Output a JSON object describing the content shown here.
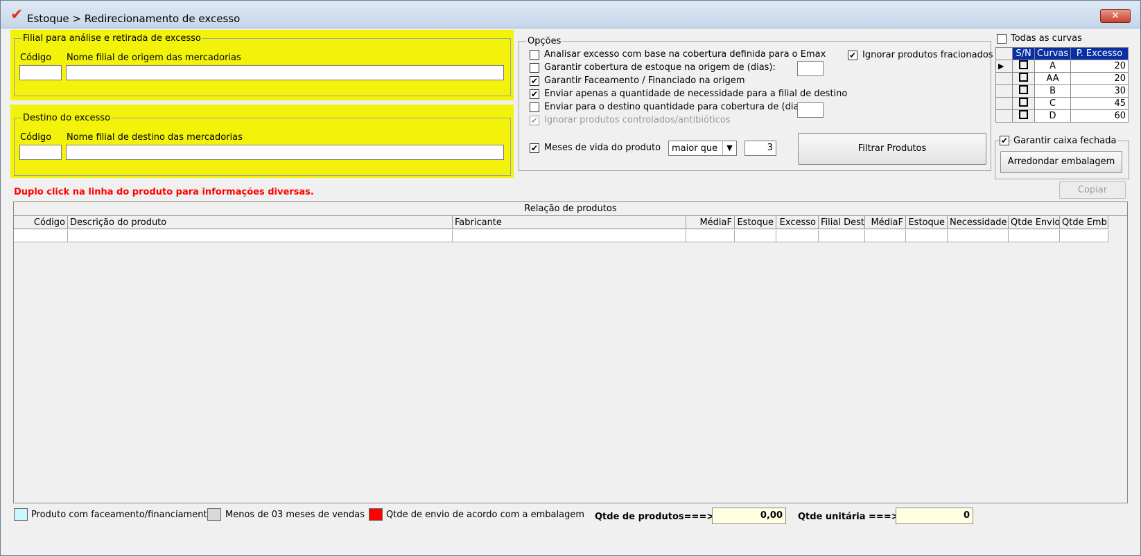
{
  "window": {
    "title": "Estoque > Redirecionamento de excesso",
    "close_label": "✕"
  },
  "origin": {
    "legend": "Filial para análise e retirada de excesso",
    "code_label": "Código",
    "name_label": "Nome filial de origem das mercadorias",
    "code_value": "",
    "name_value": ""
  },
  "destination": {
    "legend": "Destino do excesso",
    "code_label": "Código",
    "name_label": "Nome filial de destino das mercadorias",
    "code_value": "",
    "name_value": ""
  },
  "options": {
    "legend": "Opções",
    "items": [
      {
        "label": "Analisar excesso com base na cobertura definida para o Emax",
        "checked": false
      },
      {
        "label": "Garantir cobertura de estoque na origem de (dias):",
        "checked": false
      },
      {
        "label": "Garantir Faceamento / Financiado na origem",
        "checked": true
      },
      {
        "label": "Enviar apenas a quantidade de necessidade para a filial de destino",
        "checked": true
      },
      {
        "label": "Enviar para o destino quantidade para cobertura de (dias):",
        "checked": false
      },
      {
        "label": "Ignorar produtos controlados/antibióticos",
        "checked": true,
        "disabled": true
      }
    ],
    "ignore_fractional": {
      "label": "Ignorar produtos fracionados",
      "checked": true
    },
    "months_life": {
      "label": "Meses de vida do produto",
      "checked": true,
      "operator": "maior que",
      "value": "3"
    },
    "filter_button": "Filtrar Produtos"
  },
  "curves": {
    "all_label": "Todas as curvas",
    "headers": [
      "S/N",
      "Curvas",
      "P. Excesso"
    ],
    "rows": [
      {
        "curve": "A",
        "value": "20"
      },
      {
        "curve": "AA",
        "value": "20"
      },
      {
        "curve": "B",
        "value": "30"
      },
      {
        "curve": "C",
        "value": "45"
      },
      {
        "curve": "D",
        "value": "60"
      }
    ]
  },
  "packaging": {
    "legend": "Garantir caixa fechada",
    "button": "Arredondar embalagem"
  },
  "hint": "Duplo click na linha do produto para informações diversas.",
  "copy_button": "Copiar",
  "grid": {
    "title": "Relação de produtos",
    "columns": [
      "Código",
      "Descrição do produto",
      "Fabricante",
      "MédiaF",
      "Estoque",
      "Excesso",
      "Filial Dest",
      "MédiaF",
      "Estoque",
      "Necessidade",
      "Qtde Envio",
      "Qtde Emb."
    ]
  },
  "legend_items": [
    {
      "label": "Produto com faceamento/financiamento",
      "color": "#c8f7ff"
    },
    {
      "label": "Menos de 03 meses de vendas",
      "color": "#d9d9d9"
    },
    {
      "label": "Qtde de envio de acordo com a embalagem",
      "color": "#ff0000"
    }
  ],
  "totals": {
    "products_label": "Qtde de produtos===>",
    "products_value": "0,00",
    "units_label": "Qtde unitária ===>",
    "units_value": "0"
  },
  "colors": {
    "highlight": "#f2f20a",
    "hint": "#ff0000",
    "header_blue": "#0a2ea3"
  }
}
